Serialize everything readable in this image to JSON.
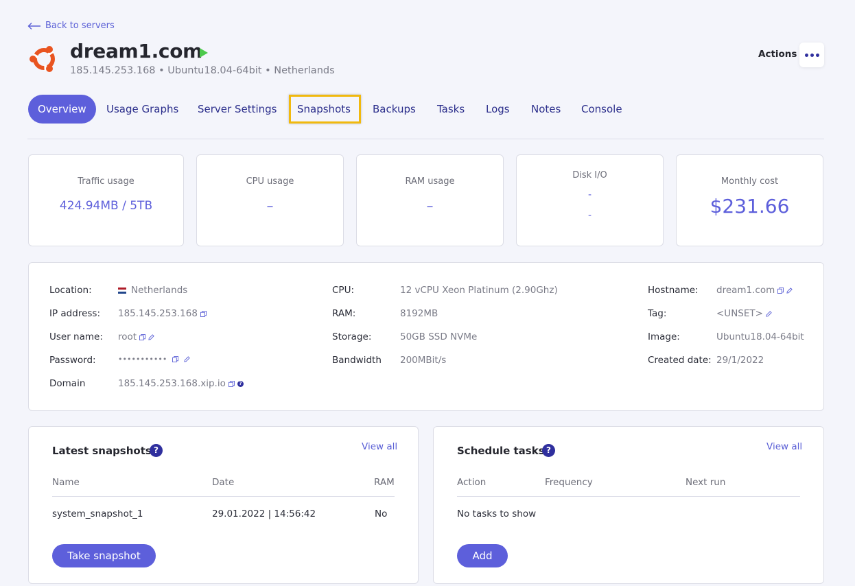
{
  "header": {
    "back_label": "Back to servers",
    "server_name": "dream1.com",
    "server_subtitle": "185.145.253.168 • Ubuntu18.04-64bit • Netherlands",
    "actions_label": "Actions",
    "logo": "ubuntu-logo",
    "status": "running"
  },
  "tabs": [
    {
      "label": "Overview",
      "active": true
    },
    {
      "label": "Usage Graphs"
    },
    {
      "label": "Server Settings"
    },
    {
      "label": "Snapshots",
      "highlighted": true
    },
    {
      "label": "Backups"
    },
    {
      "label": "Tasks"
    },
    {
      "label": "Logs"
    },
    {
      "label": "Notes"
    },
    {
      "label": "Console"
    }
  ],
  "stats": {
    "traffic": {
      "label": "Traffic usage",
      "value": "424.94MB / 5TB"
    },
    "cpu": {
      "label": "CPU usage",
      "value": "–"
    },
    "ram": {
      "label": "RAM usage",
      "value": "–"
    },
    "disk": {
      "label": "Disk I/O",
      "value1": "-",
      "value2": "-"
    },
    "cost": {
      "label": "Monthly cost",
      "value": "$231.66"
    }
  },
  "info": {
    "col1": [
      {
        "k": "Location:",
        "v": "Netherlands"
      },
      {
        "k": "IP address:",
        "v": "185.145.253.168"
      },
      {
        "k": "User name:",
        "v": "root"
      },
      {
        "k": "Password:",
        "v": "•••••••••••"
      },
      {
        "k": "Domain",
        "v": "185.145.253.168.xip.io"
      }
    ],
    "col2": [
      {
        "k": "CPU:",
        "v": "12 vCPU Xeon Platinum (2.90Ghz)"
      },
      {
        "k": "RAM:",
        "v": "8192MB"
      },
      {
        "k": "Storage:",
        "v": "50GB SSD NVMe"
      },
      {
        "k": "Bandwidth",
        "v": "200MBit/s"
      }
    ],
    "col3": [
      {
        "k": "Hostname:",
        "v": "dream1.com"
      },
      {
        "k": "Tag:",
        "v": "<UNSET>"
      },
      {
        "k": "Image:",
        "v": "Ubuntu18.04-64bit"
      },
      {
        "k": "Created date:",
        "v": "29/1/2022"
      }
    ]
  },
  "snapshots": {
    "title": "Latest snapshots",
    "view_all": "View all",
    "columns": [
      "Name",
      "Date",
      "RAM"
    ],
    "rows": [
      {
        "name": "system_snapshot_1",
        "date": "29.01.2022 | 14:56:42",
        "ram": "No"
      }
    ],
    "button": "Take snapshot"
  },
  "tasks": {
    "title": "Schedule tasks",
    "view_all": "View all",
    "columns": [
      "Action",
      "Frequency",
      "Next run"
    ],
    "empty": "No tasks to show",
    "button": "Add"
  },
  "colors": {
    "accent": "#5d5fdb",
    "dark_accent": "#2f2f9e",
    "highlight": "#f1b90e",
    "play": "#4cc94c"
  }
}
